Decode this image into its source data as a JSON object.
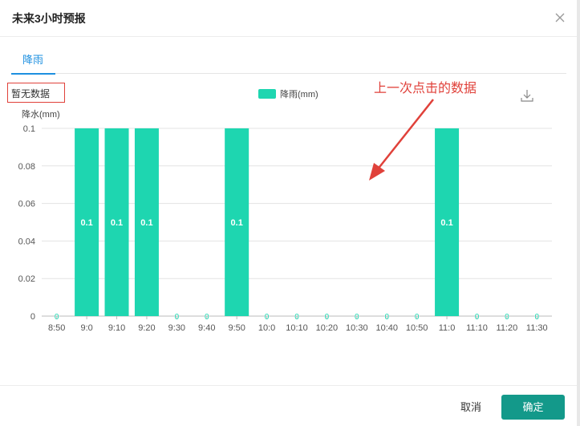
{
  "dialog": {
    "title": "未来3小时预报",
    "close_icon": "close-icon"
  },
  "tabs": [
    {
      "label": "降雨",
      "active": true
    }
  ],
  "no_data_label": "暂无数据",
  "annotation_text": "上一次点击的数据",
  "download_icon": "download-icon",
  "footer": {
    "cancel_label": "取消",
    "ok_label": "确定"
  },
  "colors": {
    "bar": "#1ed6b0",
    "accent": "#1e90e0",
    "annotation": "#e0413a",
    "ok_button": "#13998a"
  },
  "chart_data": {
    "type": "bar",
    "categories": [
      "8:50",
      "9:0",
      "9:10",
      "9:20",
      "9:30",
      "9:40",
      "9:50",
      "10:0",
      "10:10",
      "10:20",
      "10:30",
      "10:40",
      "10:50",
      "11:0",
      "11:10",
      "11:20",
      "11:30"
    ],
    "series": [
      {
        "name": "降雨(mm)",
        "values": [
          0,
          0.1,
          0.1,
          0.1,
          0,
          0,
          0.1,
          0,
          0,
          0,
          0,
          0,
          0,
          0.1,
          0,
          0,
          0
        ]
      }
    ],
    "ylabel": "降水(mm)",
    "ylim": [
      0,
      0.1
    ],
    "yticks": [
      0,
      0.02,
      0.04,
      0.06,
      0.08,
      0.1
    ],
    "grid": true,
    "legend_position": "top-center"
  }
}
